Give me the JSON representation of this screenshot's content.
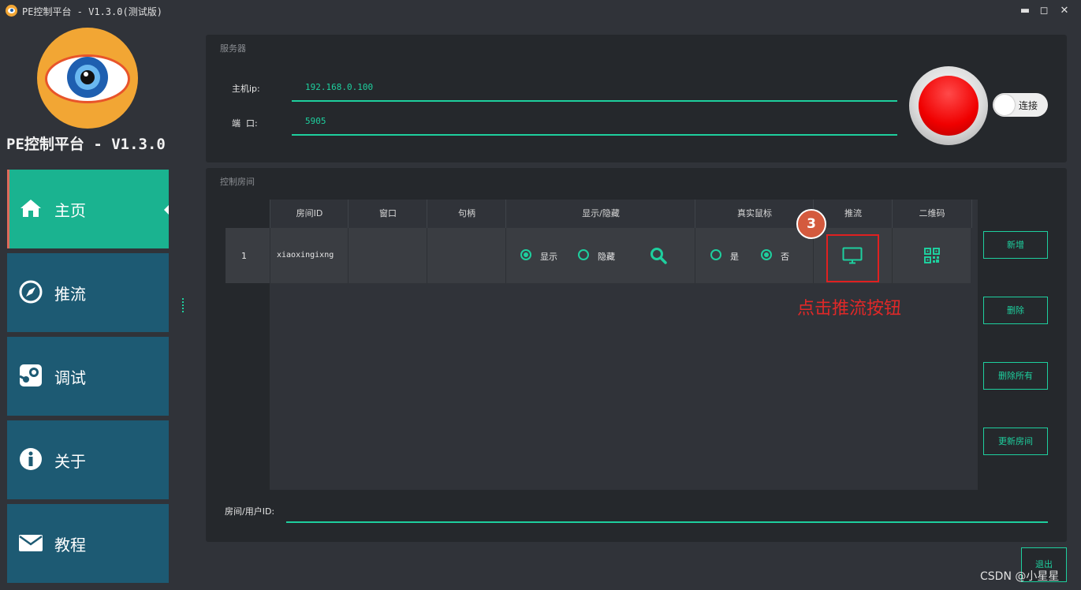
{
  "window": {
    "title": "PE控制平台 - V1.3.0(测试版)",
    "minimize": "▬",
    "maximize": "◻",
    "close": "✕"
  },
  "brand": {
    "name": "PE控制平台 - V1.3.0"
  },
  "nav": {
    "items": [
      {
        "label": "主页",
        "icon": "home-icon",
        "active": true
      },
      {
        "label": "推流",
        "icon": "compass-icon"
      },
      {
        "label": "调试",
        "icon": "steam-icon"
      },
      {
        "label": "关于",
        "icon": "info-icon"
      },
      {
        "label": "教程",
        "icon": "mail-icon"
      }
    ]
  },
  "server": {
    "section_title": "服务器",
    "host_label": "主机ip:",
    "host_value": "192.168.0.100",
    "port_label": "端  口:",
    "port_value": "5905",
    "connect_label": "连接"
  },
  "room": {
    "section_title": "控制房间",
    "columns": [
      "房间ID",
      "窗口",
      "句柄",
      "显示/隐藏",
      "真实鼠标",
      "推流",
      "二维码"
    ],
    "rows": [
      {
        "index": "1",
        "room_id": "xiaoxingixng",
        "window": "",
        "handle": "",
        "show_label": "显示",
        "hide_label": "隐藏",
        "show_selected": true,
        "mouse_yes_label": "是",
        "mouse_no_label": "否",
        "mouse_selected": "no"
      }
    ],
    "buttons": {
      "add": "新增",
      "delete": "删除",
      "delete_all": "删除所有",
      "refresh": "更新房间"
    },
    "room_user_label": "房间/用户ID:"
  },
  "exit_label": "退出",
  "annotation": {
    "step": "3",
    "text": "点击推流按钮"
  },
  "watermark": "CSDN @小星星",
  "colors": {
    "accent": "#1ecf9e",
    "nav_active": "#1ab390",
    "nav_bg": "#1d5a73",
    "annotation": "#e02020"
  }
}
